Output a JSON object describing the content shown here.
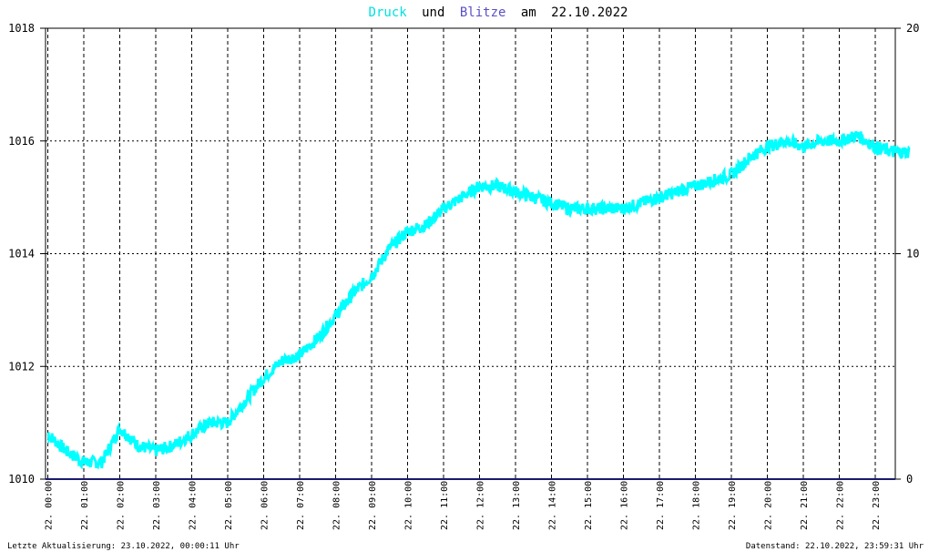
{
  "chart_data": {
    "type": "line",
    "title": {
      "series1": "Druck",
      "connector1": "und",
      "series2": "Blitze",
      "connector2": "am",
      "date": "22.10.2022"
    },
    "x_ticks": [
      "22. 00:00",
      "22. 01:00",
      "22. 02:00",
      "22. 03:00",
      "22. 04:00",
      "22. 05:00",
      "22. 06:00",
      "22. 07:00",
      "22. 08:00",
      "22. 09:00",
      "22. 10:00",
      "22. 11:00",
      "22. 12:00",
      "22. 13:00",
      "22. 14:00",
      "22. 15:00",
      "22. 16:00",
      "22. 17:00",
      "22. 18:00",
      "22. 19:00",
      "22. 20:00",
      "22. 21:00",
      "22. 22:00",
      "22. 23:00"
    ],
    "y_left": {
      "label": "",
      "ylim": [
        1010,
        1018
      ],
      "ticks": [
        "1010",
        "1012",
        "1014",
        "1016",
        "1018"
      ]
    },
    "y_right": {
      "label": "",
      "ylim": [
        0,
        20
      ],
      "ticks": [
        "0",
        "10",
        "20"
      ]
    },
    "grid": true,
    "series": [
      {
        "name": "Druck",
        "color": "#00ffff",
        "axis": "left",
        "x_hours": [
          0,
          0.5,
          1,
          1.5,
          2,
          2.5,
          3,
          3.5,
          4,
          4.5,
          5,
          5.5,
          6,
          6.5,
          7,
          7.5,
          8,
          8.5,
          9,
          9.5,
          10,
          10.5,
          11,
          11.5,
          12,
          12.5,
          13,
          13.5,
          14,
          14.5,
          15,
          15.5,
          16,
          16.5,
          17,
          17.5,
          18,
          18.5,
          19,
          19.5,
          20,
          20.5,
          21,
          21.5,
          22,
          22.5,
          23,
          23.5,
          23.95
        ],
        "values": [
          1010.8,
          1010.5,
          1010.3,
          1010.3,
          1010.9,
          1010.6,
          1010.5,
          1010.6,
          1010.8,
          1011.0,
          1011.0,
          1011.4,
          1011.8,
          1012.1,
          1012.2,
          1012.5,
          1012.9,
          1013.3,
          1013.6,
          1014.1,
          1014.4,
          1014.5,
          1014.8,
          1015.0,
          1015.2,
          1015.2,
          1015.1,
          1015.0,
          1014.9,
          1014.8,
          1014.8,
          1014.8,
          1014.8,
          1014.9,
          1015.0,
          1015.1,
          1015.2,
          1015.3,
          1015.4,
          1015.7,
          1015.9,
          1016.0,
          1015.9,
          1016.0,
          1016.0,
          1016.1,
          1015.9,
          1015.8,
          1015.8
        ]
      },
      {
        "name": "Blitze",
        "color": "#1a1a6e",
        "axis": "right",
        "x_hours": [
          0,
          23.95
        ],
        "values": [
          0,
          0
        ]
      }
    ]
  },
  "footer": {
    "last_update": "Letzte Aktualisierung: 23.10.2022, 00:00:11 Uhr",
    "data_state": "Datenstand: 22.10.2022, 23:59:31 Uhr"
  }
}
